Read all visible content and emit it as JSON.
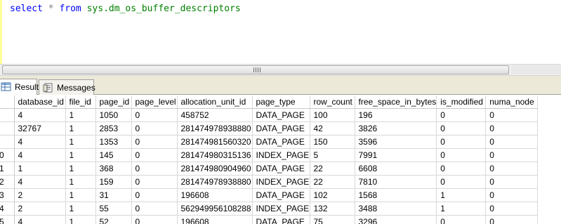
{
  "editor": {
    "query_keyword_select": "select",
    "query_star": "*",
    "query_keyword_from": "from",
    "query_object": "sys.dm_os_buffer_descriptors"
  },
  "hscroll": {
    "grip_label": "III"
  },
  "tabs": {
    "results_label": "Results",
    "messages_label": "Messages",
    "results_icon": "grid-icon",
    "messages_icon": "messages-icon"
  },
  "grid": {
    "columns": [
      "database_id",
      "file_id",
      "page_id",
      "page_level",
      "allocation_unit_id",
      "page_type",
      "row_count",
      "free_space_in_bytes",
      "is_modified",
      "numa_node"
    ],
    "rows": [
      {
        "num": "",
        "cells": [
          "4",
          "1",
          "1050",
          "0",
          "458752",
          "DATA_PAGE",
          "100",
          "196",
          "0",
          "0"
        ]
      },
      {
        "num": "",
        "cells": [
          "32767",
          "1",
          "2853",
          "0",
          "281474978938880",
          "DATA_PAGE",
          "42",
          "3826",
          "0",
          "0"
        ]
      },
      {
        "num": "",
        "cells": [
          "4",
          "1",
          "1353",
          "0",
          "281474981560320",
          "DATA_PAGE",
          "150",
          "3596",
          "0",
          "0"
        ]
      },
      {
        "num": "0",
        "cells": [
          "4",
          "1",
          "145",
          "0",
          "281474980315136",
          "INDEX_PAGE",
          "5",
          "7991",
          "0",
          "0"
        ]
      },
      {
        "num": "1",
        "cells": [
          "1",
          "1",
          "368",
          "0",
          "281474980904960",
          "DATA_PAGE",
          "22",
          "6608",
          "0",
          "0"
        ]
      },
      {
        "num": "2",
        "cells": [
          "4",
          "1",
          "159",
          "0",
          "281474978938880",
          "INDEX_PAGE",
          "22",
          "7810",
          "0",
          "0"
        ]
      },
      {
        "num": "3",
        "cells": [
          "2",
          "1",
          "31",
          "0",
          "196608",
          "DATA_PAGE",
          "102",
          "1568",
          "1",
          "0"
        ]
      },
      {
        "num": "4",
        "cells": [
          "2",
          "1",
          "55",
          "0",
          "562949956108288",
          "INDEX_PAGE",
          "132",
          "3488",
          "1",
          "0"
        ]
      },
      {
        "num": "5",
        "cells": [
          "4",
          "1",
          "52",
          "0",
          "196608",
          "DATA_PAGE",
          "75",
          "3296",
          "0",
          "0"
        ]
      }
    ]
  }
}
